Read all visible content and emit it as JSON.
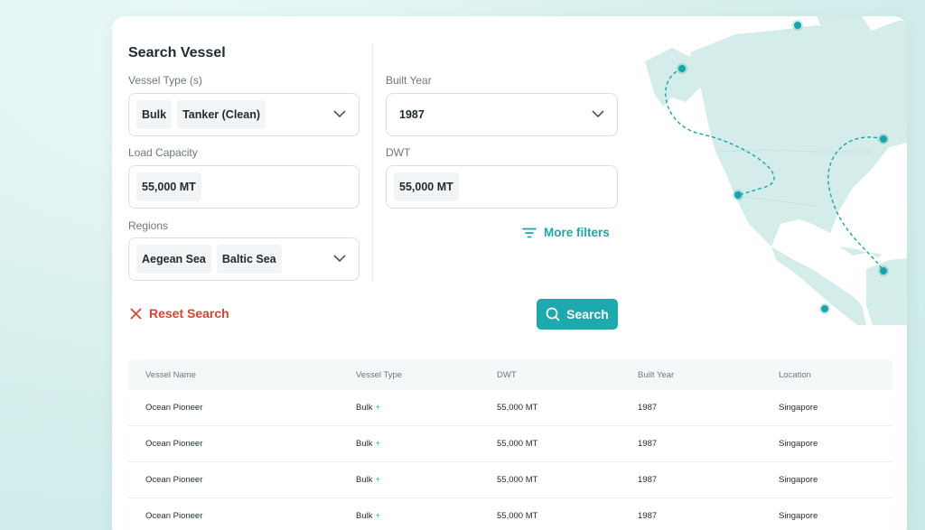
{
  "search": {
    "title": "Search Vessel",
    "vessel_type_label": "Vessel Type (s)",
    "vessel_type_chips": [
      "Bulk",
      "Tanker (Clean)"
    ],
    "built_year_label": "Built Year",
    "built_year_value": "1987",
    "load_capacity_label": "Load Capacity",
    "load_capacity_value": "55,000 MT",
    "dwt_label": "DWT",
    "dwt_value": "55,000 MT",
    "regions_label": "Regions",
    "regions_chips": [
      "Aegean Sea",
      "Baltic Sea"
    ],
    "more_filters_label": "More filters",
    "reset_label": "Reset Search",
    "search_button_label": "Search"
  },
  "table": {
    "headers": [
      "Vessel Name",
      "Vessel Type",
      "DWT",
      "Built Year",
      "Location"
    ],
    "rows": [
      {
        "name": "Ocean Pioneer",
        "type": "Bulk",
        "plus": "+",
        "dwt": "55,000 MT",
        "year": "1987",
        "location": "Singapore"
      },
      {
        "name": "Ocean Pioneer",
        "type": "Bulk",
        "plus": "+",
        "dwt": "55,000 MT",
        "year": "1987",
        "location": "Singapore"
      },
      {
        "name": "Ocean Pioneer",
        "type": "Bulk",
        "plus": "+",
        "dwt": "55,000 MT",
        "year": "1987",
        "location": "Singapore"
      },
      {
        "name": "Ocean Pioneer",
        "type": "Bulk",
        "plus": "+",
        "dwt": "55,000 MT",
        "year": "1987",
        "location": "Singapore"
      }
    ]
  },
  "colors": {
    "accent": "#1ea9ae",
    "reset": "#d9452f",
    "map_land": "#d4ecea",
    "route_dot": "#1ba4a8"
  },
  "icons": {
    "chevron": "chevron-down-icon",
    "filter": "filter-lines-icon",
    "close": "close-icon",
    "search": "search-icon",
    "plus": "plus-icon"
  }
}
